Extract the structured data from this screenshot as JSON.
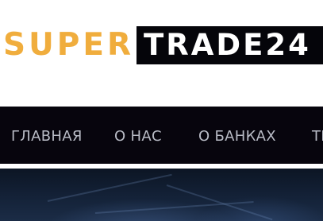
{
  "logo": {
    "part1": "SUPER",
    "part2": "TRADE24",
    "part1_color": "#f0ad3d",
    "part2_bg": "#05050a"
  },
  "nav": {
    "items": [
      {
        "label": "ГЛАВНАЯ"
      },
      {
        "label": "О НАС"
      },
      {
        "label": "О БАНКАХ"
      },
      {
        "label": "ТЕ"
      }
    ],
    "background": "#07050d",
    "text_color": "#b9bcc6"
  },
  "hero": {
    "background": "#142238"
  }
}
